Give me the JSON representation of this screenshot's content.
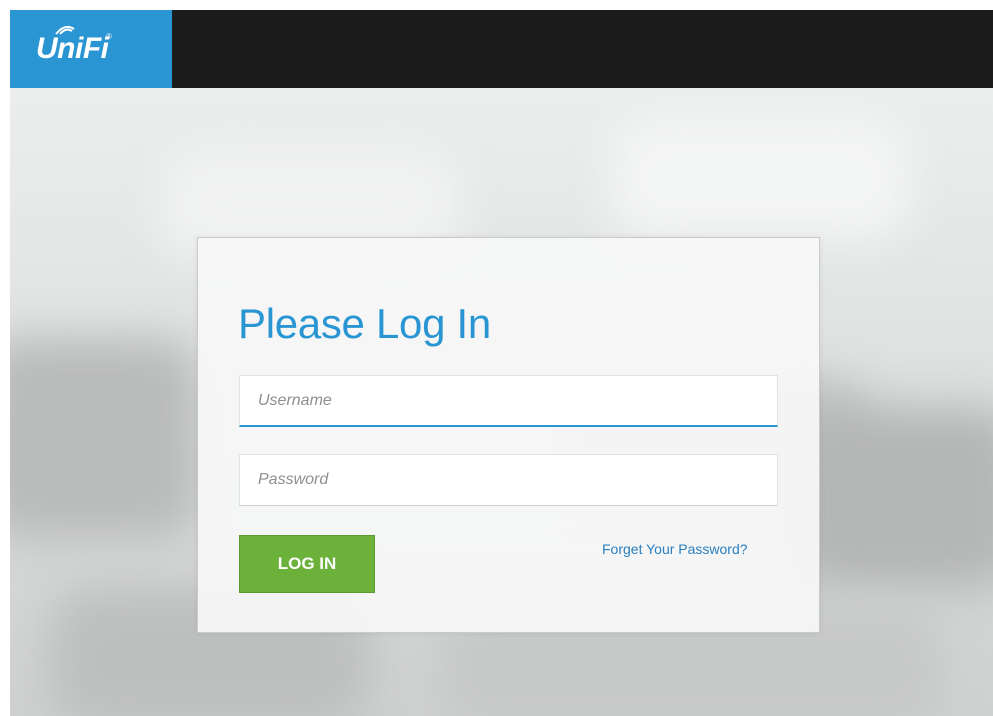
{
  "header": {
    "brand_text": "UniFi",
    "brand_mark": "®",
    "brand_color": "#2a95d3",
    "bar_color": "#1c1c1c"
  },
  "login": {
    "title": "Please Log In",
    "username_placeholder": "Username",
    "password_placeholder": "Password",
    "login_button": "LOG IN",
    "forgot_link": "Forget Your Password?",
    "accent_color": "#2a95d3",
    "button_color": "#6bb13a"
  }
}
